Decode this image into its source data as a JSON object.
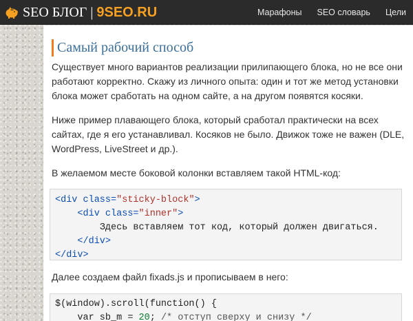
{
  "header": {
    "logo_text": "SEO БЛОГ",
    "logo_separator": "|",
    "logo_brand": "9SEO.RU",
    "brand_color": "#f5a020",
    "nav": [
      {
        "label": "Марафоны"
      },
      {
        "label": "SEO словарь"
      },
      {
        "label": "Цели"
      }
    ]
  },
  "article": {
    "title": "Самый рабочий способ",
    "para1": [
      "Существует много вариантов реализации прилипающего блока, но не все они",
      "работают корректно. Скажу из личного опыта: один и тот же метод установки",
      "блока может сработать на одном сайте, а на другом появятся косяки."
    ],
    "para2": [
      "Ниже пример плавающего блока, который сработал практически на всех",
      "сайтах, где я его устанавливал. Косяков не было. Движок тоже не важен (DLE,",
      "WordPress, LiveStreet и др.)."
    ],
    "para3": "В желаемом месте боковой колонки вставляем такой HTML-код:",
    "code1": {
      "l1_open": "<div",
      "l1_attr": " class=",
      "l1_val": "\"sticky-block\"",
      "l1_close": ">",
      "l2_open": "<div",
      "l2_attr": " class=",
      "l2_val": "\"inner\"",
      "l2_close": ">",
      "l3_text": "Здесь вставляем тот код, который должен двигаться.",
      "l4": "</div>",
      "l5": "</div>"
    },
    "para4": "Далее создаем файл fixads.js и прописываем в него:",
    "code2": {
      "l1": "$(window).scroll(function() {",
      "l2_a": "var sb_m = ",
      "l2_num": "20",
      "l2_b": "; ",
      "l2_cmt": "/* отступ сверху и снизу */"
    }
  }
}
